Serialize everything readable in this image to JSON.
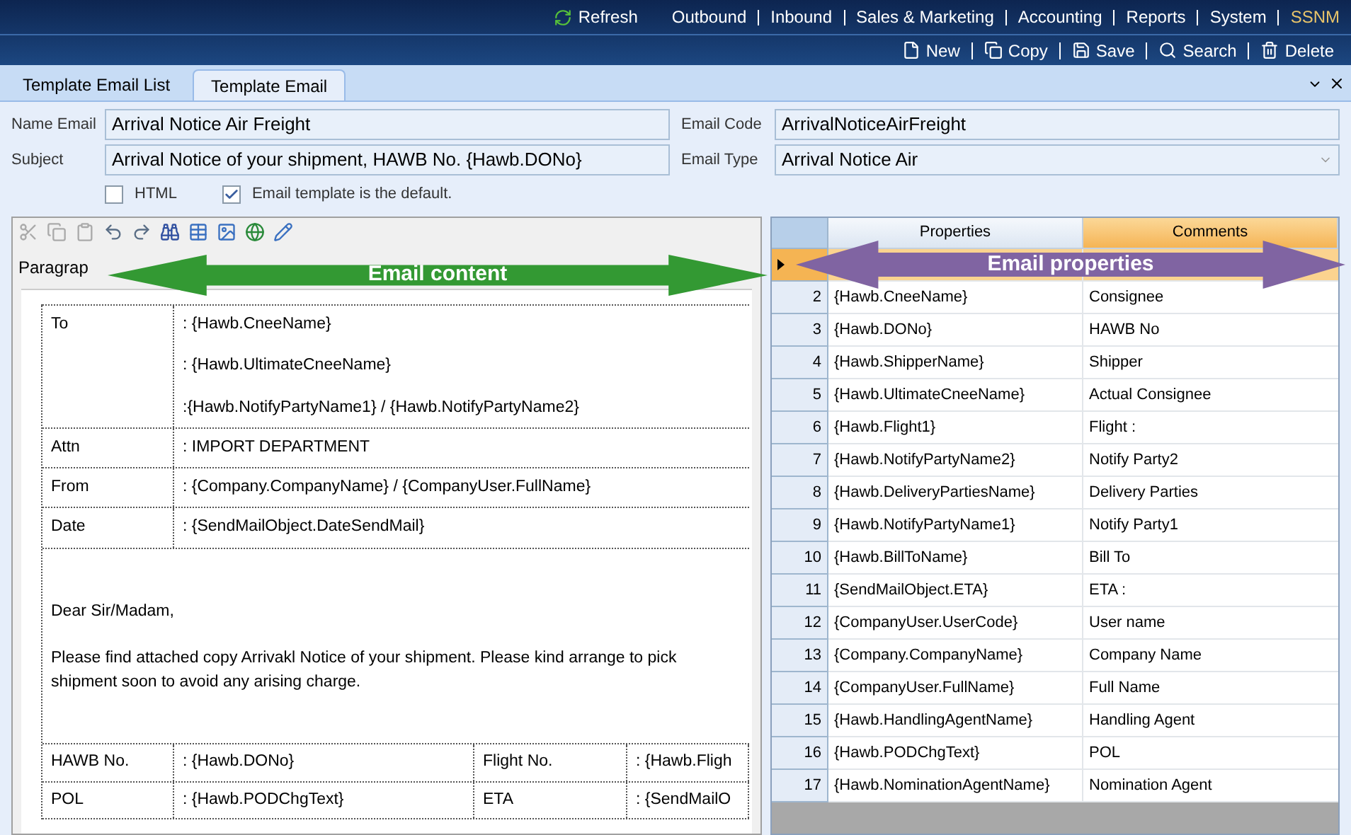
{
  "nav": {
    "refresh": "Refresh",
    "menu": [
      "Outbound",
      "Inbound",
      "Sales & Marketing",
      "Accounting",
      "Reports",
      "System"
    ],
    "user": "SSNM"
  },
  "actions": [
    {
      "kind": "new",
      "label": "New"
    },
    {
      "kind": "copy",
      "label": "Copy"
    },
    {
      "kind": "save",
      "label": "Save"
    },
    {
      "kind": "search",
      "label": "Search"
    },
    {
      "kind": "delete",
      "label": "Delete"
    }
  ],
  "tabs": [
    {
      "label": "Template Email List",
      "selected": false
    },
    {
      "label": "Template Email",
      "selected": true
    }
  ],
  "form": {
    "name_email": {
      "label": "Name Email",
      "value": "Arrival Notice Air Freight"
    },
    "subject": {
      "label": "Subject",
      "value": "Arrival Notice of your shipment, HAWB No. {Hawb.DONo}"
    },
    "email_code": {
      "label": "Email Code",
      "value": "ArrivalNoticeAirFreight"
    },
    "email_type": {
      "label": "Email Type",
      "value": "Arrival Notice Air"
    },
    "checkboxes": [
      {
        "label": "HTML",
        "checked": false
      },
      {
        "label": "Email template is the default.",
        "checked": true
      }
    ]
  },
  "editor": {
    "format_dropdown": "Paragrap",
    "header_rows": [
      {
        "label": "To",
        "values": [
          ": {Hawb.CneeName}",
          ": {Hawb.UltimateCneeName}",
          ":{Hawb.NotifyPartyName1} / {Hawb.NotifyPartyName2}"
        ]
      },
      {
        "label": "Attn",
        "values": [
          ": IMPORT DEPARTMENT"
        ]
      },
      {
        "label": "From",
        "values": [
          ": {Company.CompanyName} / {CompanyUser.FullName}"
        ]
      },
      {
        "label": "Date",
        "values": [
          ": {SendMailObject.DateSendMail}"
        ]
      }
    ],
    "greeting": "Dear Sir/Madam,",
    "body_lines": [
      "Please find attached copy Arrivakl Notice of your shipment. Please kind arrange to pick",
      "shipment soon to avoid any arising charge."
    ],
    "detail_rows": [
      {
        "cells": [
          "HAWB No.",
          ": {Hawb.DONo}",
          "Flight No.",
          ": {Hawb.Fligh"
        ]
      },
      {
        "cells": [
          "POL",
          ": {Hawb.PODChgText}",
          "ETA",
          ": {SendMailO"
        ]
      }
    ]
  },
  "grid": {
    "columns": [
      {
        "label": "Properties",
        "selected": false
      },
      {
        "label": "Comments",
        "selected": true
      }
    ],
    "rows": [
      {
        "selected": true
      },
      {
        "number": "2",
        "property": "{Hawb.CneeName}",
        "comment": "Consignee",
        "selected": false
      },
      {
        "number": "3",
        "property": "{Hawb.DONo}",
        "comment": "HAWB No",
        "selected": false
      },
      {
        "number": "4",
        "property": "{Hawb.ShipperName}",
        "comment": "Shipper",
        "selected": false
      },
      {
        "number": "5",
        "property": "{Hawb.UltimateCneeName}",
        "comment": "Actual Consignee",
        "selected": false
      },
      {
        "number": "6",
        "property": "{Hawb.Flight1}",
        "comment": "Flight :",
        "selected": false
      },
      {
        "number": "7",
        "property": "{Hawb.NotifyPartyName2}",
        "comment": "Notify Party2",
        "selected": false
      },
      {
        "number": "8",
        "property": "{Hawb.DeliveryPartiesName}",
        "comment": "Delivery Parties",
        "selected": false
      },
      {
        "number": "9",
        "property": "{Hawb.NotifyPartyName1}",
        "comment": "Notify Party1",
        "selected": false
      },
      {
        "number": "10",
        "property": "{Hawb.BillToName}",
        "comment": "Bill To",
        "selected": false
      },
      {
        "number": "11",
        "property": "{SendMailObject.ETA}",
        "comment": "ETA  :",
        "selected": false
      },
      {
        "number": "12",
        "property": "{CompanyUser.UserCode}",
        "comment": "User name",
        "selected": false
      },
      {
        "number": "13",
        "property": "{Company.CompanyName}",
        "comment": "Company Name",
        "selected": false
      },
      {
        "number": "14",
        "property": "{CompanyUser.FullName}",
        "comment": "Full Name",
        "selected": false
      },
      {
        "number": "15",
        "property": "{Hawb.HandlingAgentName}",
        "comment": "Handling Agent",
        "selected": false
      },
      {
        "number": "16",
        "property": "{Hawb.PODChgText}",
        "comment": "POL",
        "selected": false
      },
      {
        "number": "17",
        "property": "{Hawb.NominationAgentName}",
        "comment": "Nomination Agent",
        "selected": false
      }
    ]
  },
  "annotations": [
    {
      "label": "Email content",
      "color": "#339933"
    },
    {
      "label": "Email properties",
      "color": "#8064a2"
    }
  ]
}
